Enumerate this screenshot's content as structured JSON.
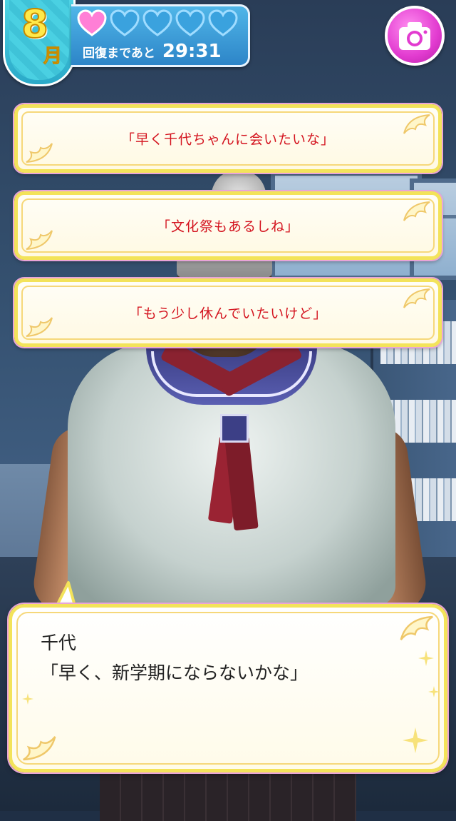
{
  "hud": {
    "month_number": "8",
    "month_unit": "月",
    "hearts": [
      {
        "state": "filled",
        "icon": "heart-filled-icon",
        "color": "#ff7fd6"
      },
      {
        "state": "empty",
        "icon": "heart-empty-icon",
        "color": "#9fdcff"
      },
      {
        "state": "empty",
        "icon": "heart-empty-icon",
        "color": "#9fdcff"
      },
      {
        "state": "empty",
        "icon": "heart-empty-icon",
        "color": "#9fdcff"
      },
      {
        "state": "empty",
        "icon": "heart-empty-icon",
        "color": "#9fdcff"
      }
    ],
    "recovery_label": "回復まであと",
    "recovery_time": "29:31",
    "camera_icon": "camera-icon"
  },
  "choices": [
    {
      "label": "「早く千代ちゃんに会いたいな」"
    },
    {
      "label": "「文化祭もあるしね」"
    },
    {
      "label": "「もう少し休んでいたいけど」"
    }
  ],
  "dialog": {
    "speaker": "千代",
    "text": "「早く、新学期にならないかな」"
  },
  "colors": {
    "choice_text": "#d4141f",
    "frame_gold": "#f3e35a",
    "month_yellow": "#ffe94a",
    "hud_blue": "#2d85c8",
    "camera_pink": "#e23bd0"
  }
}
